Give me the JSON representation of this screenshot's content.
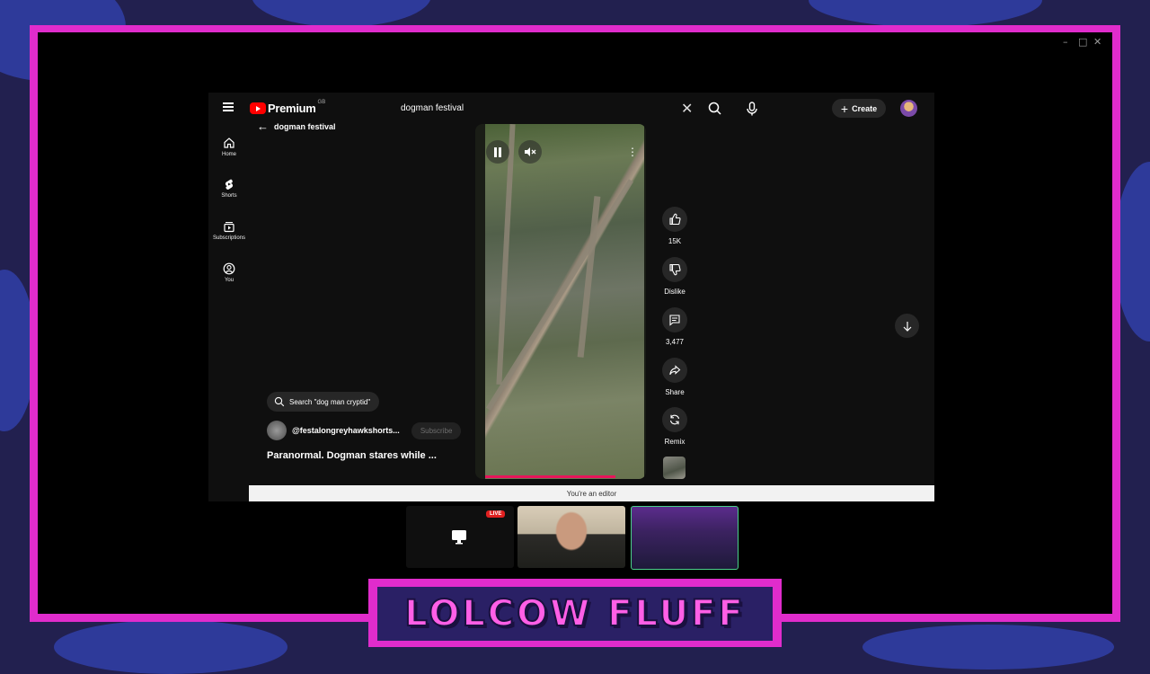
{
  "window": {
    "controls": [
      "–",
      "□",
      "✕"
    ]
  },
  "youtube": {
    "logo_text": "Premium",
    "logo_badge": "GB",
    "search": {
      "query": "dogman festival"
    },
    "create_label": "Create",
    "back_label": "dogman festival",
    "nav": [
      {
        "label": "Home",
        "icon": "home-icon"
      },
      {
        "label": "Shorts",
        "icon": "shorts-icon"
      },
      {
        "label": "Subscriptions",
        "icon": "subscriptions-icon"
      },
      {
        "label": "You",
        "icon": "you-icon"
      }
    ],
    "actions": {
      "like": "15K",
      "dislike": "Dislike",
      "comments": "3,477",
      "share": "Share",
      "remix": "Remix"
    },
    "search_chip": "Search \"dog man cryptid\"",
    "channel": "@festalongreyhawkshorts...",
    "subscribe_label": "Subscribe",
    "video_title": "Paranormal. Dogman stares while ...",
    "progress": 0.82
  },
  "editor_bar": "You're an editor",
  "stream": {
    "live_badge": "LIVE"
  },
  "banner": "LOLCOW FLUFF",
  "colors": {
    "frame": "#e02ccc",
    "accent": "#ff0000",
    "progress": "#e8155b"
  }
}
